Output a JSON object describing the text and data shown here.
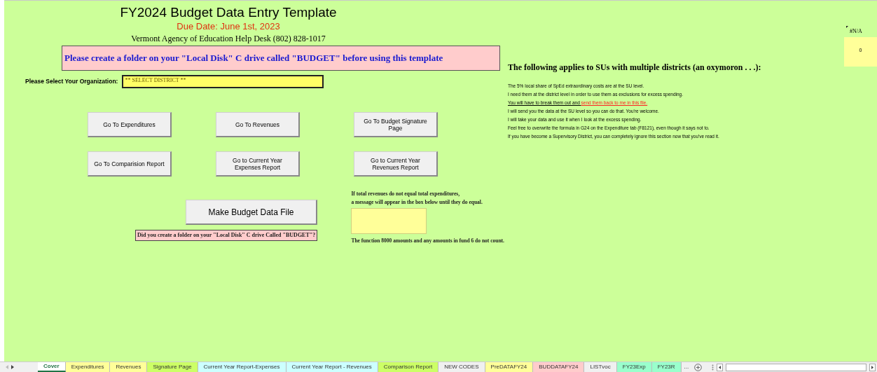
{
  "header": {
    "title": "FY2024 Budget Data Entry Template",
    "due_date": "Due Date: June 1st, 2023",
    "help_desk": "Vermont Agency of Education Help Desk (802) 828-1017"
  },
  "folder_notice": "Please create a folder on your \"Local Disk\" C drive called \"BUDGET\" before using this template",
  "organization": {
    "label": "Please Select Your Organization:",
    "value": "** SELECT DISTRICT **"
  },
  "nav_buttons": [
    {
      "label": "Go To Expenditures"
    },
    {
      "label": "Go To Revenues"
    },
    {
      "label": "Go To Budget Signature Page"
    },
    {
      "label": "Go To Comparision Report"
    },
    {
      "label": "Go to Current Year Expenses Report"
    },
    {
      "label": "Go to Current Year Revenues Report"
    }
  ],
  "make_button": "Make Budget Data File",
  "folder_question": "Did you create a folder on your \"Local Disk\" C drive Called \"BUDGET\"?",
  "balance_note": [
    "If total revenues do not equal total expenditures,",
    "a message will appear in the box below until they do equal."
  ],
  "balance_footnote": "The function 8000 amounts and any amounts in fund 6 do not count.",
  "su_section": {
    "heading": "The following applies to SUs with multiple districts (an oxymoron . . .):",
    "lines": [
      {
        "kind": "plain",
        "text": "The 5% local share of SpEd extraordinary costs are at the SU level."
      },
      {
        "kind": "plain",
        "text": "I need them at the district level in order to use them as exclusions for excess spending."
      },
      {
        "kind": "underlined",
        "text": "You will have to break them out and ",
        "highlight": "send them back to me in this file."
      },
      {
        "kind": "plain",
        "text": "I will send you the data at the SU level so you can do that.  You're welcome."
      },
      {
        "kind": "plain",
        "text": "I will take your data and use it when I look at the excess spending."
      },
      {
        "kind": "plain",
        "text": "Feel free to overwrite the formula in G24 on the Expenditure tab (F8121), even though it says not to."
      },
      {
        "kind": "plain",
        "text": "If you have become a Supervisory District, you can completely ignore this section now that you've read it."
      }
    ]
  },
  "error_cell": "#N/A",
  "total_cell": "0",
  "sheet_tabs": [
    {
      "label": "Cover",
      "selected": true
    },
    {
      "label": "Expenditures",
      "selected": false,
      "color": "#ffff99"
    },
    {
      "label": "Revenues",
      "selected": false,
      "color": "#ffff99"
    },
    {
      "label": "Signature Page",
      "selected": false,
      "color": "#ccff66"
    },
    {
      "label": "Current Year Report-Expenses",
      "selected": false,
      "color": "#ccffff"
    },
    {
      "label": "Current Year Report - Revenues",
      "selected": false,
      "color": "#ccffff"
    },
    {
      "label": "Comparison Report",
      "selected": false,
      "color": "#ccff66"
    },
    {
      "label": "NEW CODES",
      "selected": false
    },
    {
      "label": "PreDATAFY24",
      "selected": false,
      "color": "#ffff99"
    },
    {
      "label": "BUDDATAFY24",
      "selected": false,
      "color": "#ffcccc"
    },
    {
      "label": "LISTvoc",
      "selected": false
    },
    {
      "label": "FY23Exp",
      "selected": false,
      "color": "#99ffcc"
    },
    {
      "label": "FY23R",
      "selected": false,
      "color": "#99ffcc"
    }
  ],
  "tab_overflow": "..."
}
